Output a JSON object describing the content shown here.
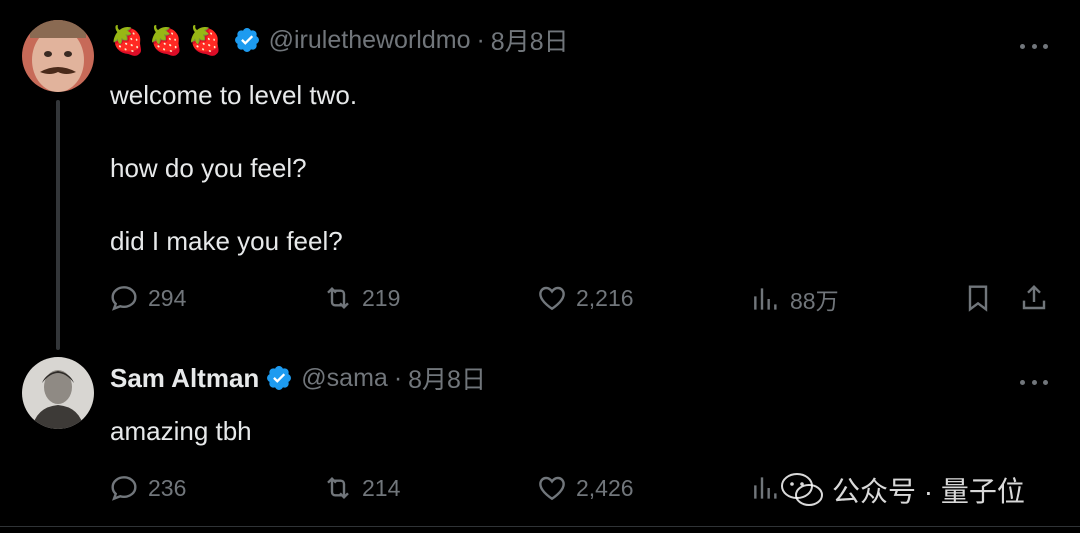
{
  "tweets": [
    {
      "emojis": [
        "🍓",
        "🍓",
        "🍓"
      ],
      "display_name": "",
      "handle": "@iruletheworldmo",
      "separator": "·",
      "date": "8月8日",
      "lines": [
        "welcome to level two.",
        "how do you feel?",
        "did I make you feel?"
      ],
      "replies": "294",
      "retweets": "219",
      "likes": "2,216",
      "views": "88万"
    },
    {
      "display_name": "Sam Altman",
      "handle": "@sama",
      "separator": "·",
      "date": "8月8日",
      "lines": [
        "amazing tbh"
      ],
      "replies": "236",
      "retweets": "214",
      "likes": "2,426"
    }
  ],
  "watermark": {
    "text": "公众号 · 量子位"
  },
  "colors": {
    "background": "#000000",
    "text": "#e7e9ea",
    "muted": "#71767b",
    "verified": "#1d9bf0"
  }
}
